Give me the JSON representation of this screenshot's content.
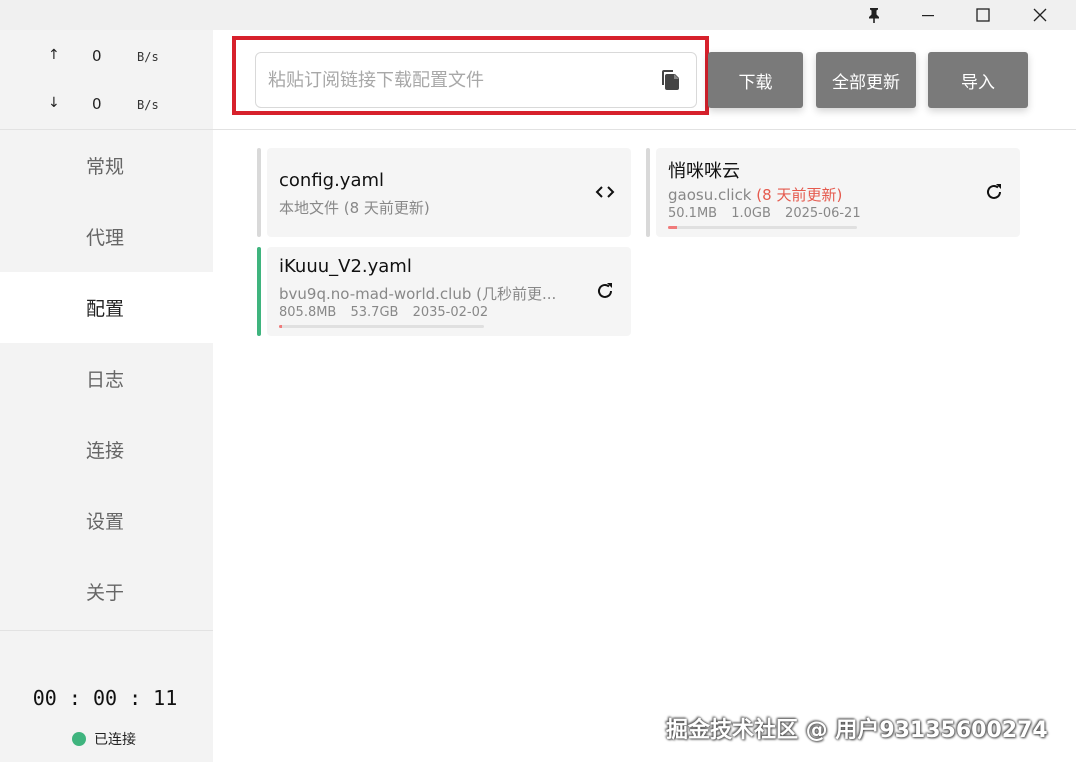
{
  "titlebar": {
    "pin_icon": "pin-icon",
    "minimize_icon": "minimize-icon",
    "maximize_icon": "maximize-icon",
    "close_icon": "close-icon"
  },
  "traffic": {
    "up_arrow": "↑",
    "up_value": "0",
    "up_unit": "B/s",
    "down_arrow": "↓",
    "down_value": "0",
    "down_unit": "B/s"
  },
  "nav": {
    "items": [
      {
        "label": "常规"
      },
      {
        "label": "代理"
      },
      {
        "label": "配置"
      },
      {
        "label": "日志"
      },
      {
        "label": "连接"
      },
      {
        "label": "设置"
      },
      {
        "label": "关于"
      }
    ],
    "active_index": 2
  },
  "footer": {
    "timer": "00 : 00 : 11",
    "status": "已连接",
    "status_color": "#3fb47e"
  },
  "toolbar": {
    "url_placeholder": "粘贴订阅链接下载配置文件",
    "url_value": "",
    "download_label": "下载",
    "update_all_label": "全部更新",
    "import_label": "导入",
    "highlight_color": "#d7212c",
    "button_color": "#7a7a7a"
  },
  "profiles": [
    {
      "title": "config.yaml",
      "subtitle": "本地文件 (8 天前更新)",
      "icon": "code-icon"
    },
    {
      "title": "悄咪咪云",
      "subtitle_host": "gaosu.click",
      "subtitle_note": "(8 天前更新)",
      "used": "50.1MB",
      "total": "1.0GB",
      "expire": "2025-06-21",
      "progress": 0.05,
      "icon": "refresh-icon"
    },
    {
      "title": "iKuuu_V2.yaml",
      "subtitle": "bvu9q.no-mad-world.club (几秒前更...",
      "used": "805.8MB",
      "total": "53.7GB",
      "expire": "2035-02-02",
      "progress": 0.015,
      "selected_color": "#3fb47e",
      "icon": "refresh-icon"
    }
  ],
  "watermark": "掘金技术社区 @ 用户93135600274"
}
